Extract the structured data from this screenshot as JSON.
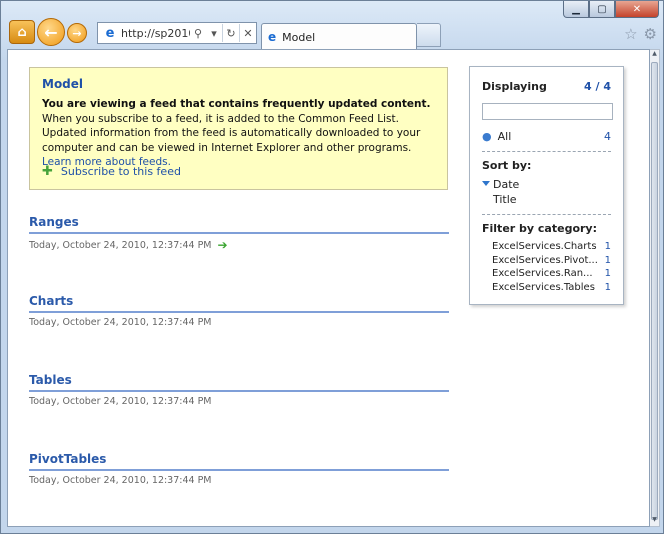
{
  "browser": {
    "address_text": "http://sp2010...",
    "tab_label": "Model"
  },
  "info": {
    "title": "Model",
    "bold_text": "You are viewing a feed that contains frequently updated content.",
    "body_text": " When you subscribe to a feed, it is added to the Common Feed List. Updated information from the feed is automatically downloaded to your computer and can be viewed in Internet Explorer and other programs. ",
    "learn_more": "Learn more about feeds.",
    "subscribe_link": "Subscribe to this feed"
  },
  "entries": [
    {
      "title": "Ranges",
      "date": "Today, October 24, 2010, 12:37:44 PM"
    },
    {
      "title": "Charts",
      "date": "Today, October 24, 2010, 12:37:44 PM"
    },
    {
      "title": "Tables",
      "date": "Today, October 24, 2010, 12:37:44 PM"
    },
    {
      "title": "PivotTables",
      "date": "Today, October 24, 2010, 12:37:44 PM"
    }
  ],
  "panel": {
    "displaying_label": "Displaying",
    "displaying_count": "4 / 4",
    "all_label": "All",
    "all_count": "4",
    "sort_label": "Sort by:",
    "sort_options": [
      "Date",
      "Title"
    ],
    "filter_label": "Filter by category:",
    "categories": [
      {
        "name": "ExcelServices.Charts",
        "count": "1"
      },
      {
        "name": "ExcelServices.Pivot...",
        "count": "1"
      },
      {
        "name": "ExcelServices.Ran...",
        "count": "1"
      },
      {
        "name": "ExcelServices.Tables",
        "count": "1"
      }
    ]
  },
  "colors": {
    "link_blue": "#1f51a8",
    "info_bg": "#ffffc2",
    "entry_rule": "#7f9fd8"
  }
}
